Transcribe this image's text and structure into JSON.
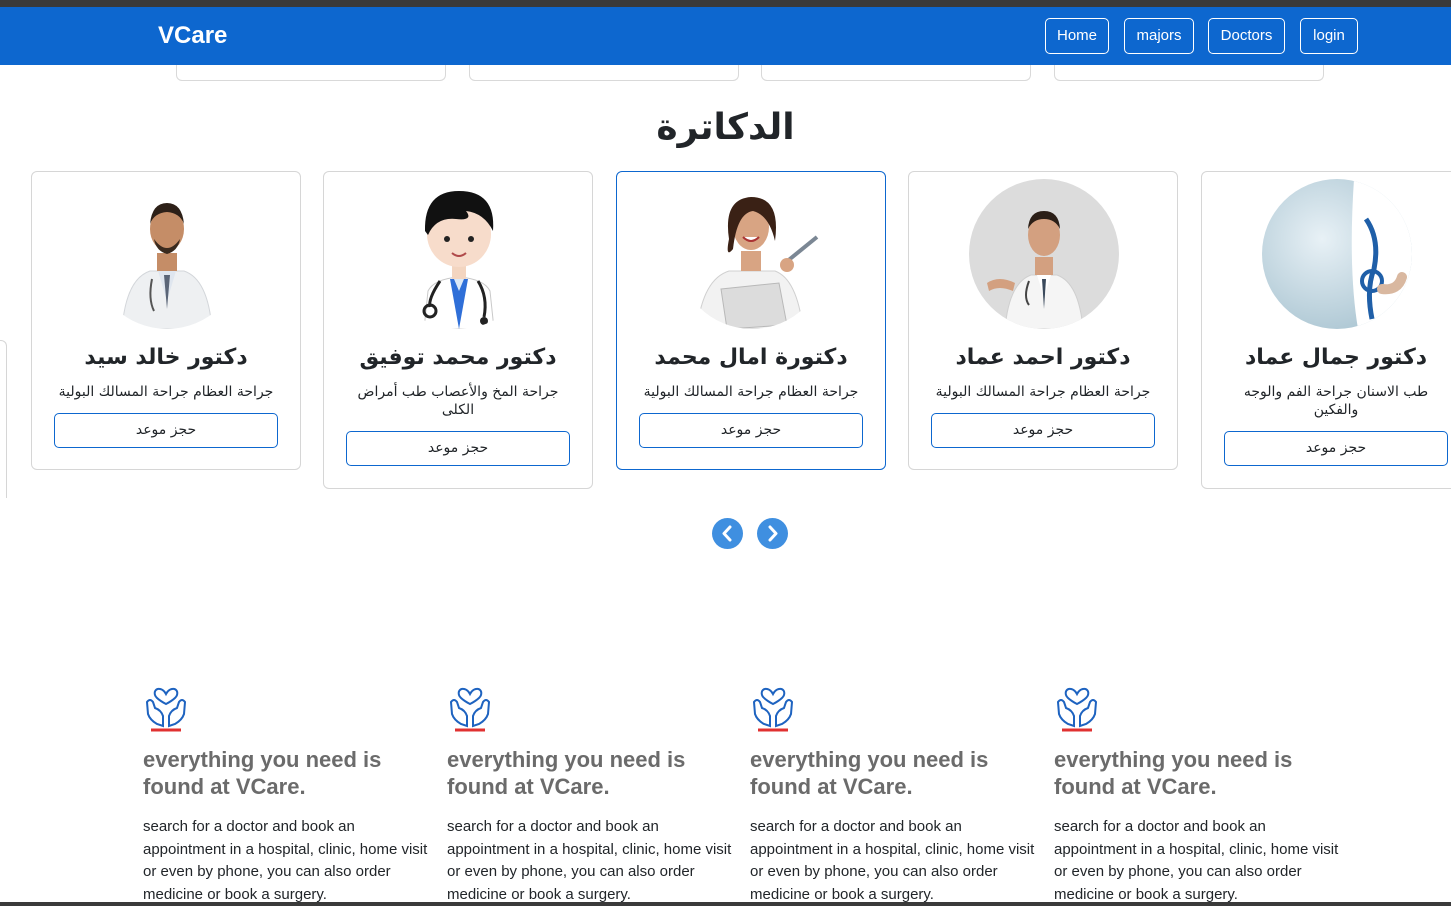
{
  "nav": {
    "brand": "VCare",
    "links": [
      "Home",
      "majors",
      "Doctors",
      "login"
    ]
  },
  "doctors_section": {
    "title": "الدكاترة",
    "cards": [
      {
        "name": "دكتور خالد سيد",
        "specialty": "جراحة العظام جراحة المسالك البولية",
        "button": "حجز موعد"
      },
      {
        "name": "دكتور محمد توفيق",
        "specialty": "جراحة المخ والأعصاب طب أمراض الكلى",
        "button": "حجز موعد"
      },
      {
        "name": "دكتورة امال محمد",
        "specialty": "جراحة العظام جراحة المسالك البولية",
        "button": "حجز موعد"
      },
      {
        "name": "دكتور احمد عماد",
        "specialty": "جراحة العظام جراحة المسالك البولية",
        "button": "حجز موعد"
      },
      {
        "name": "دكتور جمال عماد",
        "specialty": "طب الاسنان جراحة الفم والوجه والفكين",
        "button": "حجز موعد"
      }
    ],
    "prev_icon": "chevron-left-icon",
    "next_icon": "chevron-right-icon"
  },
  "features": [
    {
      "icon": "heart-hands-icon",
      "title": "everything you need is found at VCare.",
      "text": "search for a doctor and book an appointment in a hospital, clinic, home visit or even by phone, you can also order medicine or book a surgery."
    },
    {
      "icon": "heart-hands-icon",
      "title": "everything you need is found at VCare.",
      "text": "search for a doctor and book an appointment in a hospital, clinic, home visit or even by phone, you can also order medicine or book a surgery."
    },
    {
      "icon": "heart-hands-icon",
      "title": "everything you need is found at VCare.",
      "text": "search for a doctor and book an appointment in a hospital, clinic, home visit or even by phone, you can also order medicine or book a surgery."
    },
    {
      "icon": "heart-hands-icon",
      "title": "everything you need is found at VCare.",
      "text": "search for a doctor and book an appointment in a hospital, clinic, home visit or even by phone, you can also order medicine or book a surgery."
    }
  ],
  "colors": {
    "navbar": "#0d67cf",
    "accent_blue": "#3f8fe0",
    "icon_red": "#e03131"
  }
}
